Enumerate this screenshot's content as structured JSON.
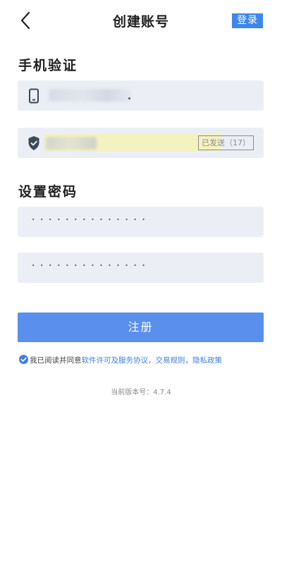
{
  "header": {
    "title": "创建账号",
    "login_label": "登录"
  },
  "phone_section": {
    "title": "手机验证",
    "phone_value_blurred": true,
    "resend_label": "已发送（17）"
  },
  "password_section": {
    "title": "设置密码",
    "password_mask": "··············",
    "confirm_mask": "··············"
  },
  "register": {
    "label": "注册"
  },
  "agreement": {
    "checked": true,
    "prefix": "我已阅读并同意",
    "link_license": "软件许可及服务协议",
    "sep": "，",
    "link_trade": "交易规则",
    "sep2": "，",
    "link_privacy": "隐私政策"
  },
  "footer": {
    "version": "当前版本号：4.7.4"
  },
  "colors": {
    "accent": "#3f86ea",
    "button": "#5a8fee",
    "field_bg": "#ebeff5",
    "highlight": "#f5f2c2"
  },
  "icons": {
    "back": "chevron-left-icon",
    "phone": "phone-icon",
    "shield": "shield-check-icon",
    "check": "check-circle-icon"
  }
}
